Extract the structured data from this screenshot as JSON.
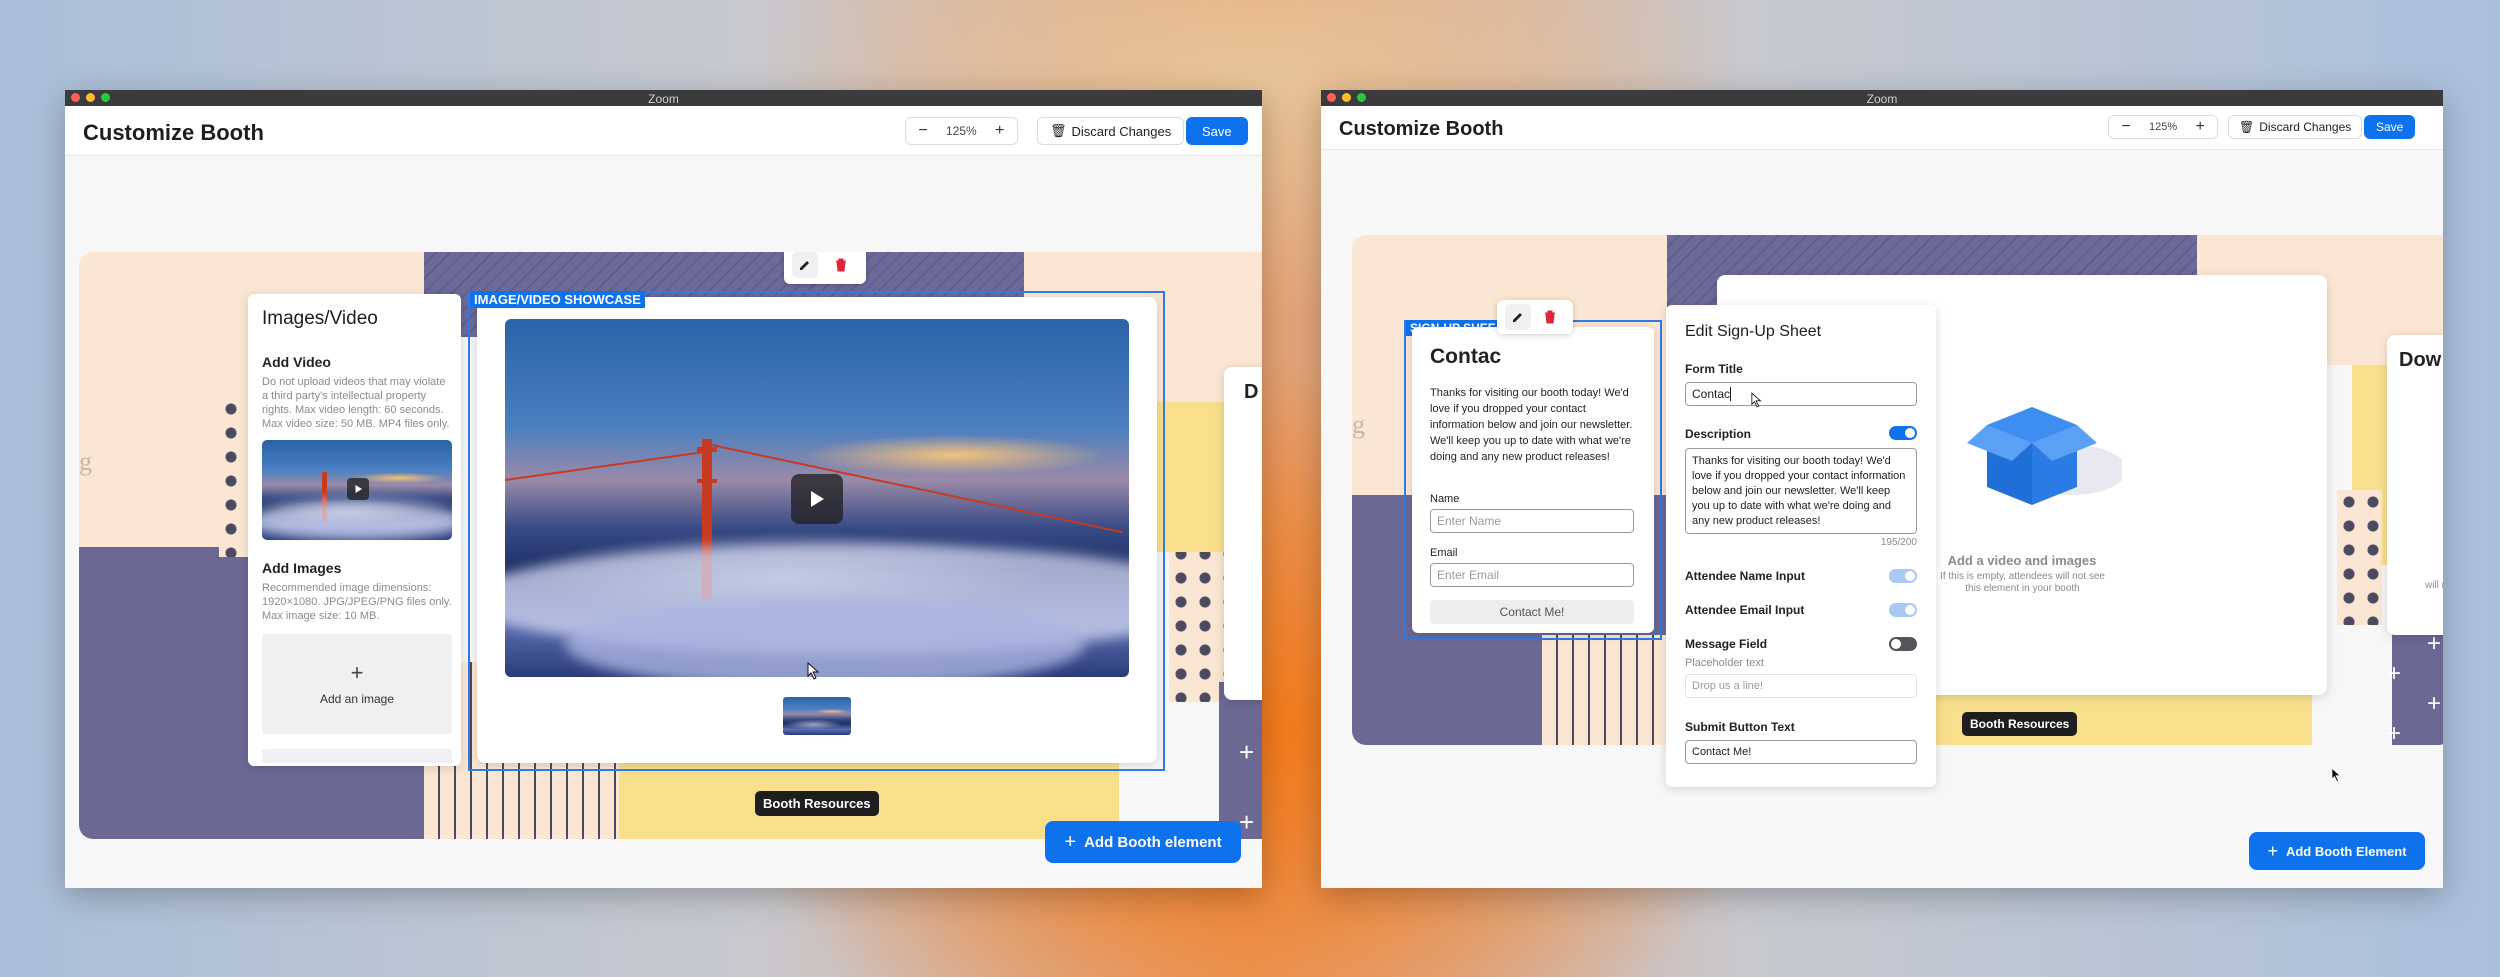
{
  "colors": {
    "accent": "#0e72ed",
    "delete": "#e0243a",
    "selection": "#2f7be6"
  },
  "left": {
    "window_title": "Zoom",
    "app_title": "Customize Booth",
    "zoom_minus": "−",
    "zoom_value": "125%",
    "zoom_plus": "+",
    "discard_label": "Discard Changes",
    "save_label": "Save",
    "panel": {
      "title": "Images/Video",
      "add_video_heading": "Add Video",
      "add_video_help": "Do not upload videos that may violate a third party's intellectual property rights. Max video length: 60 seconds. Max video size: 50 MB. MP4 files only.",
      "add_images_heading": "Add Images",
      "add_images_help": "Recommended image dimensions: 1920×1080. JPG/JPEG/PNG files only. Max image size: 10 MB.",
      "add_image_plus": "+",
      "add_image_label": "Add an image"
    },
    "selection_label": "IMAGE/VIDEO SHOWCASE",
    "peek_letter": "D",
    "side_letter": "g",
    "booth_resources": "Booth Resources",
    "add_element_label": "Add Booth element",
    "plus_sign": "+"
  },
  "right": {
    "window_title": "Zoom",
    "app_title": "Customize Booth",
    "zoom_minus": "−",
    "zoom_value": "125%",
    "zoom_plus": "+",
    "discard_label": "Discard Changes",
    "save_label": "Save",
    "selection_label": "SIGN-UP SHEE",
    "side_letter": "g",
    "signup": {
      "title": "Contac",
      "description": "Thanks for visiting our booth today! We'd love if you dropped your contact information below and join our newsletter. We'll keep you up to date with what we're doing and any new product releases!",
      "name_label": "Name",
      "name_placeholder": "Enter Name",
      "email_label": "Email",
      "email_placeholder": "Enter Email",
      "submit_label": "Contact Me!"
    },
    "edit": {
      "title": "Edit Sign-Up Sheet",
      "form_title_label": "Form Title",
      "form_title_value": "Contac",
      "description_label": "Description",
      "description_value": "Thanks for visiting our booth today! We'd love if you dropped your contact information below and join our newsletter. We'll keep you up to date with what we're doing and any new product releases!",
      "char_count": "195/200",
      "attendee_name_label": "Attendee Name Input",
      "attendee_email_label": "Attendee Email Input",
      "message_field_label": "Message Field",
      "placeholder_text_label": "Placeholder text",
      "placeholder_text_value": "Drop us a line!",
      "submit_button_text_label": "Submit Button Text",
      "submit_button_text_value": "Contact Me!"
    },
    "media": {
      "title": "Add a video and images",
      "hint": "If this is empty, attendees will not see this element in your booth"
    },
    "peek_title": "Dow",
    "peek_hint": "will n",
    "booth_resources": "Booth Resources",
    "add_element_label": "Add Booth Element",
    "plus_sign": "+"
  }
}
